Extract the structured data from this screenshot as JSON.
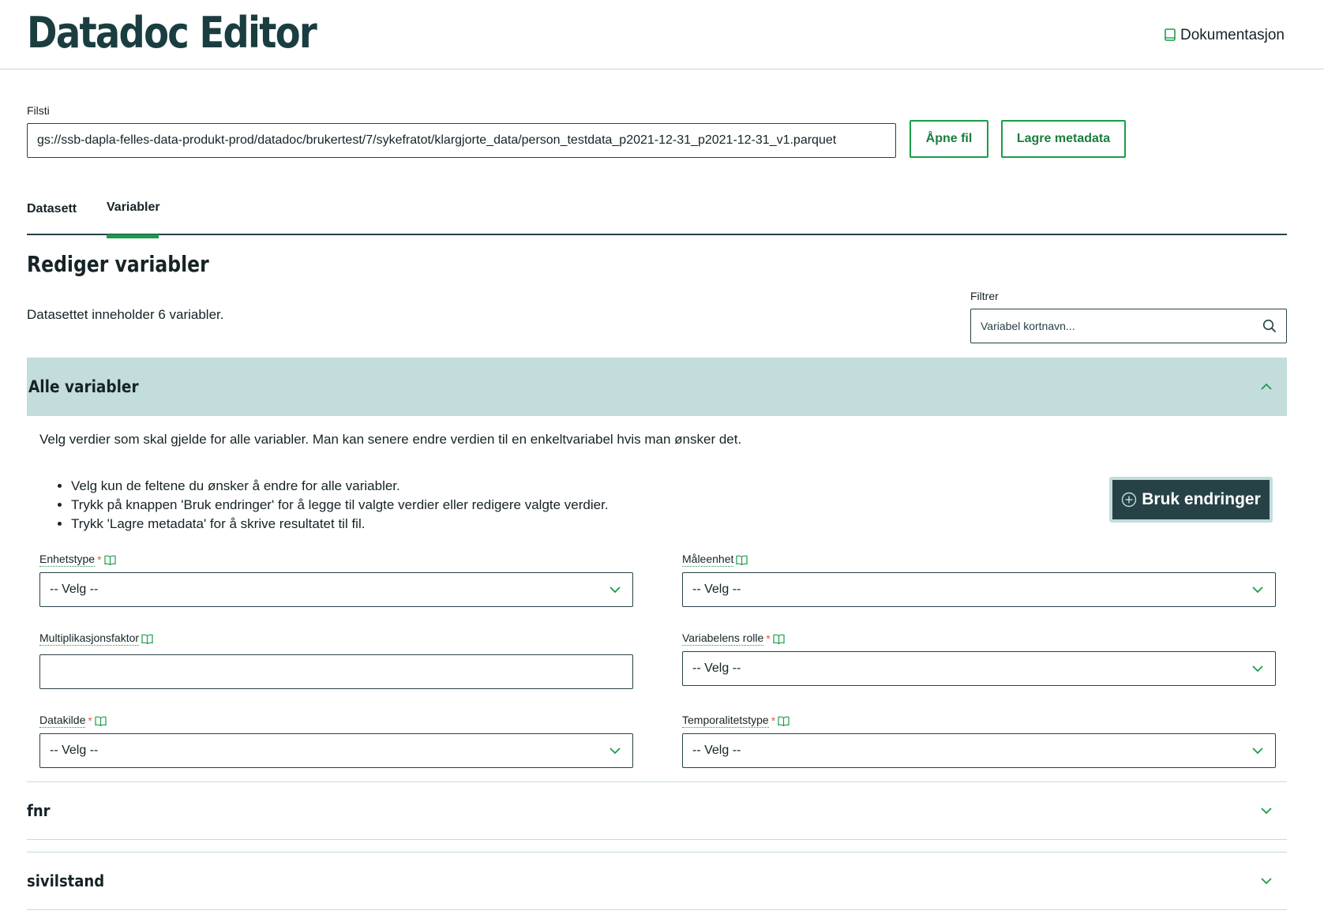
{
  "header": {
    "title": "Datadoc Editor",
    "doc_link": "Dokumentasjon"
  },
  "file": {
    "label": "Filsti",
    "path": "gs://ssb-dapla-felles-data-produkt-prod/datadoc/brukertest/7/sykefratot/klargjorte_data/person_testdata_p2021-12-31_p2021-12-31_v1.parquet",
    "open_button": "Åpne fil",
    "save_button": "Lagre metadata"
  },
  "tabs": [
    {
      "label": "Datasett",
      "active": false
    },
    {
      "label": "Variabler",
      "active": true
    }
  ],
  "main": {
    "title": "Rediger variabler",
    "count_text": "Datasettet inneholder 6 variabler.",
    "filter_label": "Filtrer",
    "filter_placeholder": "Variabel kortnavn..."
  },
  "all_variables": {
    "title": "Alle variabler",
    "expanded": true,
    "description": "Velg verdier som skal gjelde for alle variabler. Man kan senere endre verdien til en enkeltvariabel hvis man ønsker det.",
    "instructions": [
      "Velg kun de feltene du ønsker å endre for alle variabler.",
      "Trykk på knappen 'Bruk endringer' for å legge til valgte verdier eller redigere valgte verdier.",
      "Trykk 'Lagre metadata' for å skrive resultatet til fil."
    ],
    "apply_button": "Bruk endringer",
    "fields": {
      "enhetstype": {
        "label": "Enhetstype",
        "required": true,
        "value": "-- Velg --"
      },
      "maaleenhet": {
        "label": "Måleenhet",
        "required": false,
        "value": "-- Velg --"
      },
      "multiplikasjonsfaktor": {
        "label": "Multiplikasjonsfaktor",
        "required": false,
        "value": ""
      },
      "variabelens_rolle": {
        "label": "Variabelens rolle",
        "required": true,
        "value": "-- Velg --"
      },
      "datakilde": {
        "label": "Datakilde",
        "required": true,
        "value": "-- Velg --"
      },
      "temporalitetstype": {
        "label": "Temporalitetstype",
        "required": true,
        "value": "-- Velg --"
      }
    },
    "required_mark": "*"
  },
  "variables": [
    {
      "name": "fnr"
    },
    {
      "name": "sivilstand"
    }
  ],
  "colors": {
    "brand_dark": "#274247",
    "brand_green": "#1a9d49",
    "accordion_bg": "#c3dcdc",
    "required": "#ed5935"
  }
}
